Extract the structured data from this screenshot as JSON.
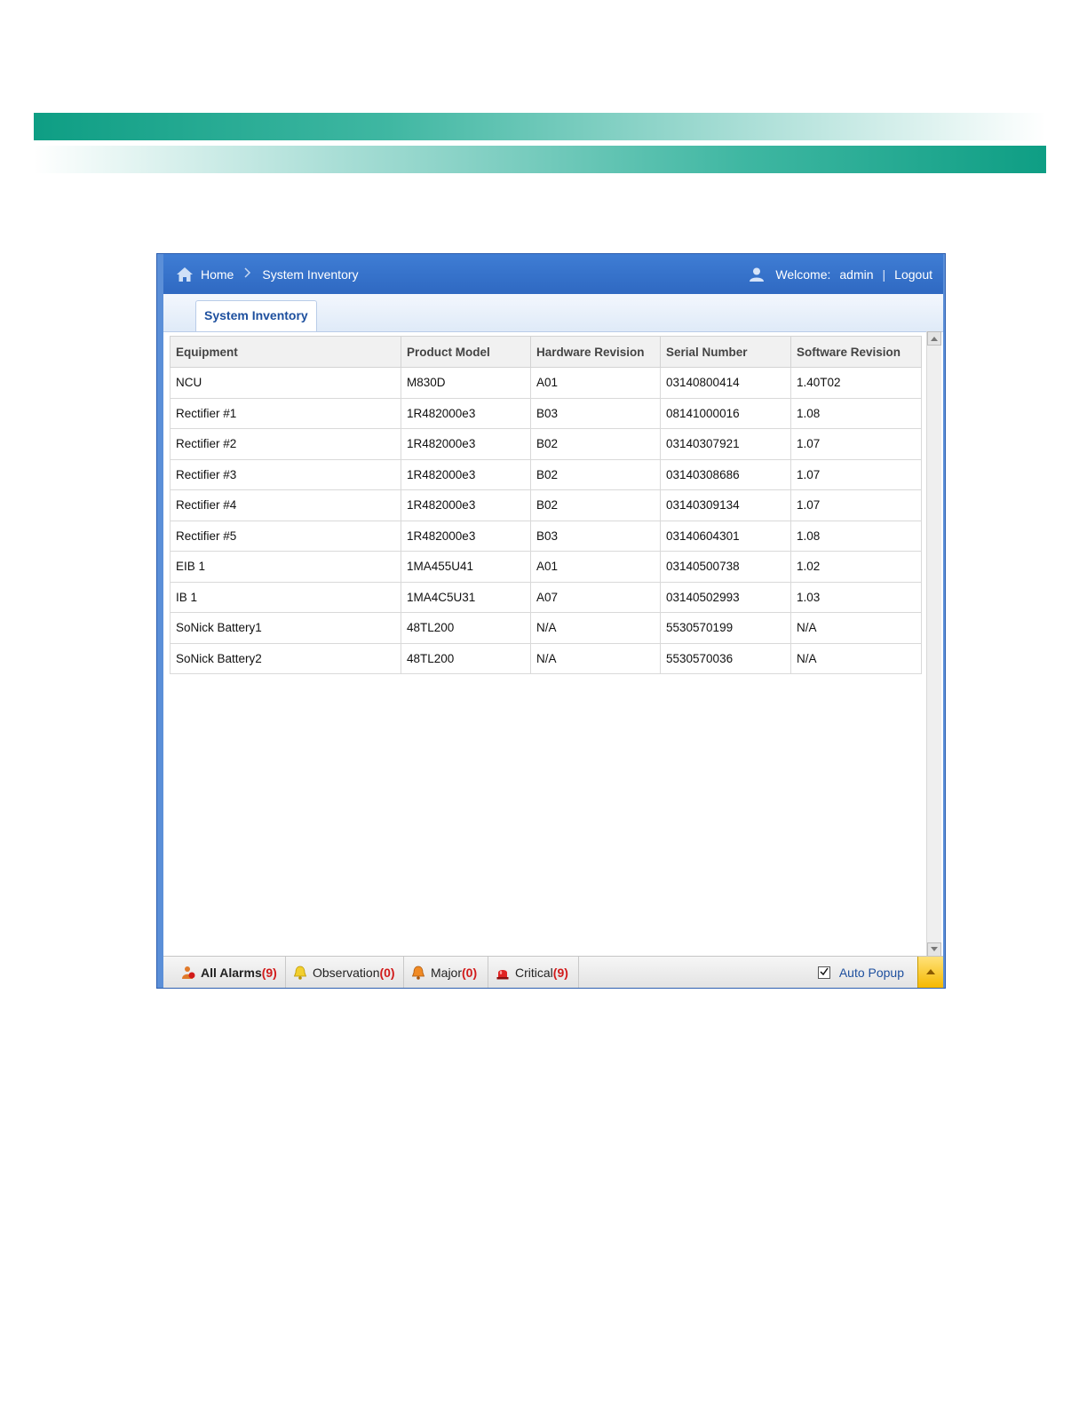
{
  "breadcrumb": {
    "home": "Home",
    "separator": ">",
    "current": "System Inventory"
  },
  "user": {
    "welcome_label": "Welcome:",
    "name": "admin",
    "divider": "|",
    "logout": "Logout"
  },
  "tab": {
    "label": "System Inventory"
  },
  "table": {
    "columns": [
      "Equipment",
      "Product Model",
      "Hardware Revision",
      "Serial Number",
      "Software Revision"
    ],
    "rows": [
      [
        "NCU",
        "M830D",
        "A01",
        "03140800414",
        "1.40T02"
      ],
      [
        "Rectifier #1",
        "1R482000e3",
        "B03",
        "08141000016",
        "1.08"
      ],
      [
        "Rectifier #2",
        "1R482000e3",
        "B02",
        "03140307921",
        "1.07"
      ],
      [
        "Rectifier #3",
        "1R482000e3",
        "B02",
        "03140308686",
        "1.07"
      ],
      [
        "Rectifier #4",
        "1R482000e3",
        "B02",
        "03140309134",
        "1.07"
      ],
      [
        "Rectifier #5",
        "1R482000e3",
        "B03",
        "03140604301",
        "1.08"
      ],
      [
        "EIB 1",
        "1MA455U41",
        "A01",
        "03140500738",
        "1.02"
      ],
      [
        "IB 1",
        "1MA4C5U31",
        "A07",
        "03140502993",
        "1.03"
      ],
      [
        "SoNick Battery1",
        "48TL200",
        "N/A",
        "5530570199",
        "N/A"
      ],
      [
        "SoNick Battery2",
        "48TL200",
        "N/A",
        "5530570036",
        "N/A"
      ]
    ]
  },
  "alarms": {
    "all": {
      "label": "All Alarms",
      "count": "(9)"
    },
    "observation": {
      "label": "Observation",
      "count": "(0)"
    },
    "major": {
      "label": "Major",
      "count": "(0)"
    },
    "critical": {
      "label": "Critical",
      "count": "(9)"
    },
    "auto_popup": {
      "label": "Auto Popup",
      "checked": true
    }
  },
  "colors": {
    "header_blue": "#2f69c2",
    "alarm_count_red": "#d11b1b",
    "brand_green": "#0e9e84"
  },
  "icons": {
    "home": "home-icon",
    "user": "user-icon",
    "all_alarms": "person-alarm-icon",
    "observation": "yellow-bell-icon",
    "major": "orange-bell-icon",
    "critical": "red-siren-icon"
  }
}
